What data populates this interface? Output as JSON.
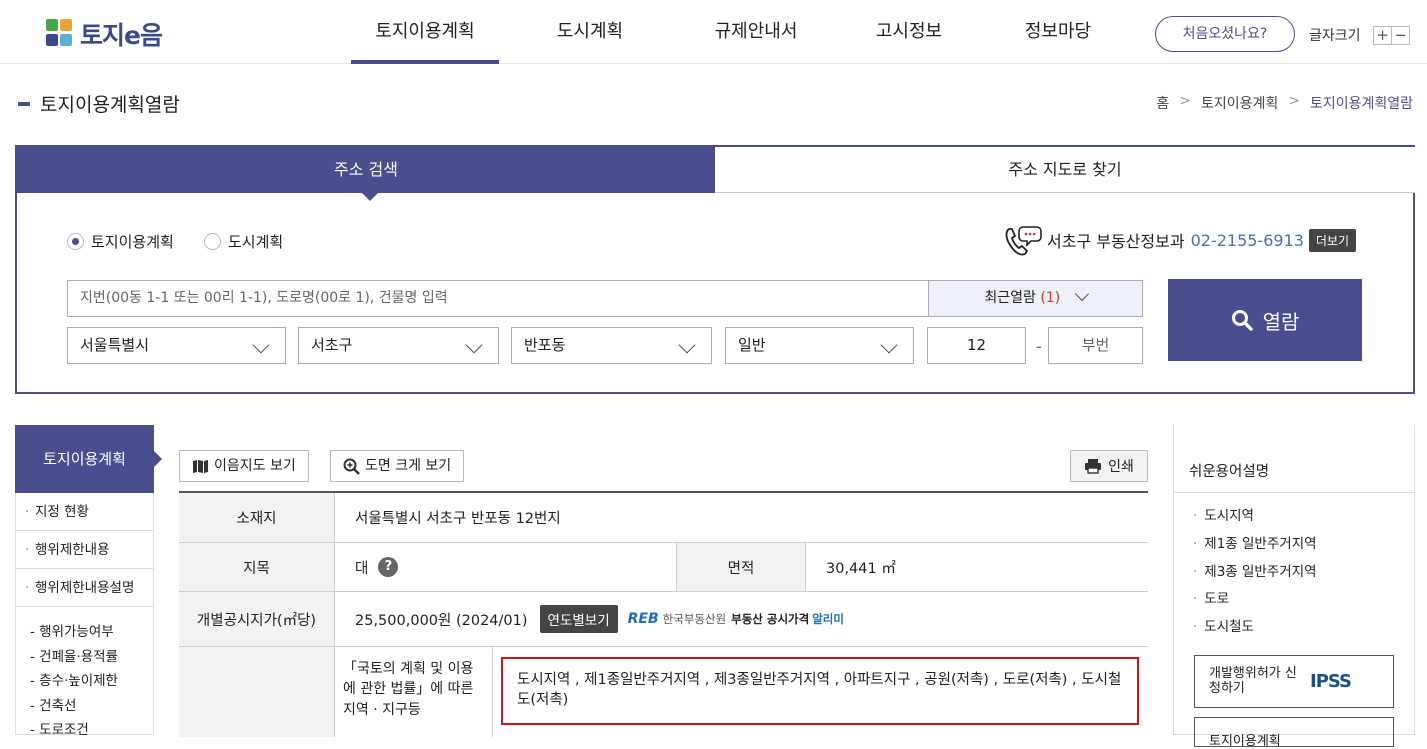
{
  "header": {
    "logo_text": "토지e음",
    "nav": [
      "토지이용계획",
      "도시계획",
      "규제안내서",
      "고시정보",
      "정보마당"
    ],
    "first_visit": "처음오셨나요?",
    "font_size_label": "글자크기",
    "font_plus": "+",
    "font_minus": "−"
  },
  "page": {
    "title": "토지이용계획열람",
    "breadcrumb": [
      "홈",
      "토지이용계획",
      "토지이용계획열람"
    ]
  },
  "search": {
    "tab_address": "주소 검색",
    "tab_map": "주소 지도로 찾기",
    "radio_land": "토지이용계획",
    "radio_city": "도시계획",
    "phone_label": "서초구 부동산정보과",
    "phone_number": "02-2155-6913",
    "more": "더보기",
    "placeholder": "지번(00동 1-1 또는 00리 1-1), 도로명(00로 1), 건물명 입력",
    "recent_label": "최근열람",
    "recent_count": "(1)",
    "sido": "서울특별시",
    "sigungu": "서초구",
    "dong": "반포동",
    "type": "일반",
    "bonbun": "12",
    "dash": "-",
    "bubun_placeholder": "부번",
    "submit": "열람"
  },
  "left_nav": {
    "head": "토지이용계획",
    "items": [
      "지정 현황",
      "행위제한내용",
      "행위제한내용설명"
    ],
    "subs": [
      "- 행위가능여부",
      "- 건폐율·용적률",
      "- 층수·높이제한",
      "- 건축선",
      "- 도로조건"
    ]
  },
  "toolbar": {
    "map_btn": "이음지도 보기",
    "zoom_btn": "도면 크게 보기",
    "print_btn": "인쇄"
  },
  "info": {
    "location_label": "소재지",
    "location": "서울특별시 서초구 반포동 12번지",
    "jimok_label": "지목",
    "jimok": "대",
    "help": "?",
    "area_label": "면적",
    "area": "30,441 ㎡",
    "price_label": "개별공시지가(㎡당)",
    "price": "25,500,000원 (2024/01)",
    "year_btn": "연도별보기",
    "reb_logo": "REB",
    "reb_name": "한국부동산원",
    "reb_service": "부동산 공시가격",
    "reb_app": "알리미",
    "law_label": "「국토의 계획 및 이용에 관한 법률」에 따른 지역 · 지구등",
    "zones": "도시지역 , 제1종일반주거지역 , 제3종일반주거지역 , 아파트지구 , 공원(저촉) , 도로(저촉) , 도시철도(저촉)"
  },
  "sidebar": {
    "title": "쉬운용어설명",
    "terms": [
      "도시지역",
      "제1종 일반주거지역",
      "제3종 일반주거지역",
      "도로",
      "도시철도"
    ],
    "ipss_label": "개발행위허가 신청하기",
    "ipss_logo": "IPSS",
    "next_label": "토지이용계획"
  }
}
